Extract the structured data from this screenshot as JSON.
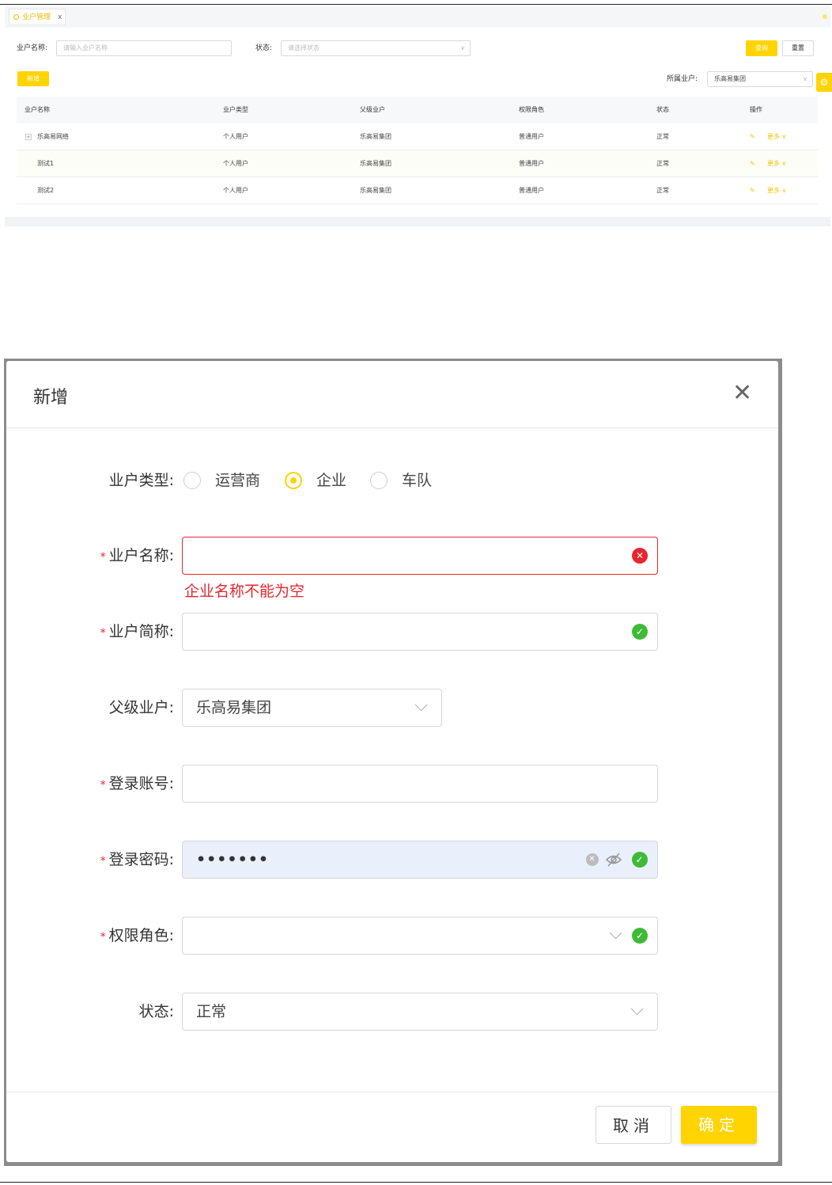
{
  "list_page": {
    "tab_label": "业户管理",
    "tab_close": "x",
    "filters": {
      "name_label": "业户名称:",
      "name_placeholder": "请输入业户名称",
      "status_label": "状态:",
      "status_placeholder": "请选择状态",
      "query_button": "查询",
      "reset_button": "重置"
    },
    "add_button": "新增",
    "owner_label": "所属业户:",
    "owner_value": "乐高易集团",
    "columns": [
      "业户名称",
      "业户类型",
      "父级业户",
      "权限角色",
      "状态",
      "操作"
    ],
    "rows": [
      {
        "name": "乐高易网络",
        "type": "个人用户",
        "parent": "乐高易集团",
        "role": "普通用户",
        "status": "正常",
        "more": "更多"
      },
      {
        "name": "测试1",
        "type": "个人用户",
        "parent": "乐高易集团",
        "role": "普通用户",
        "status": "正常",
        "more": "更多"
      },
      {
        "name": "测试2",
        "type": "个人用户",
        "parent": "乐高易集团",
        "role": "普通用户",
        "status": "正常",
        "more": "更多"
      }
    ]
  },
  "modal": {
    "title": "新增",
    "type_label": "业户类型:",
    "type_options": [
      "运营商",
      "企业",
      "车队"
    ],
    "type_selected": "企业",
    "required_mark": "*",
    "name_label": "业户名称:",
    "name_error": "企业名称不能为空",
    "short_label": "业户简称:",
    "parent_label": "父级业户:",
    "parent_value": "乐高易集团",
    "account_label": "登录账号:",
    "password_label": "登录密码:",
    "password_value": "•••••••",
    "role_label": "权限角色:",
    "status_label": "状态:",
    "status_value": "正常",
    "cancel_button": "取消",
    "confirm_button": "确定"
  },
  "colors": {
    "accent": "#ffd400",
    "error": "#e8262d",
    "success": "#3fba38"
  }
}
